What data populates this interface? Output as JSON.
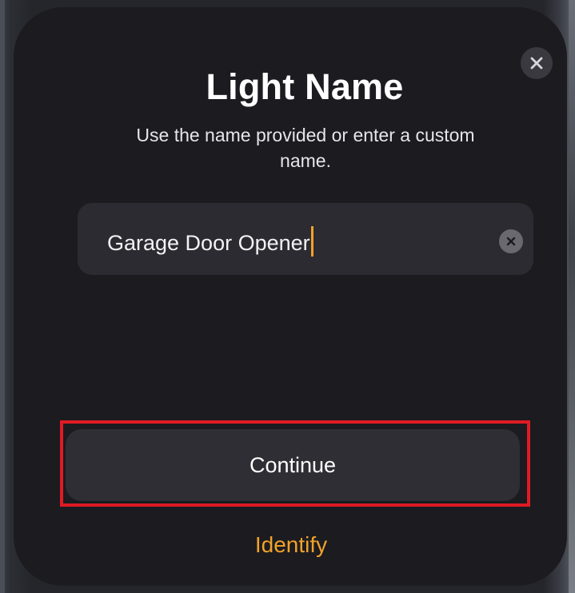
{
  "dialog": {
    "title": "Light Name",
    "subtitle": "Use the name provided or enter a custom name.",
    "name_field": {
      "value": "Garage Door Opener",
      "placeholder": ""
    },
    "continue_label": "Continue",
    "identify_label": "Identify"
  },
  "icons": {
    "close": "close-icon",
    "clear": "clear-text-icon"
  },
  "colors": {
    "sheet_background": "#1c1b20",
    "field_background": "#2c2b31",
    "button_background": "#2f2e34",
    "accent": "#f0a22a",
    "highlight_border": "#e01b24"
  }
}
